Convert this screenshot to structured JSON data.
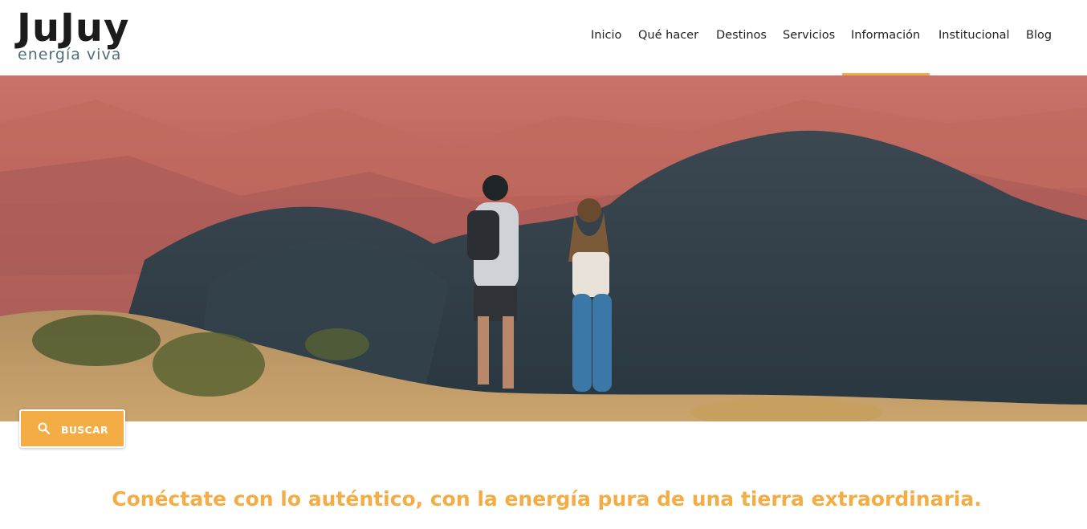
{
  "logo": {
    "title": "JuJuy",
    "subtitle": "energía viva"
  },
  "nav": {
    "items": [
      {
        "label": "Inicio"
      },
      {
        "label": "Qué hacer"
      },
      {
        "label": "Destinos"
      },
      {
        "label": "Servicios"
      },
      {
        "label": "Información"
      },
      {
        "label": "Institucional"
      },
      {
        "label": "Blog"
      }
    ],
    "active_index": 4
  },
  "hero": {
    "image_subject": "couple-holding-hands-overlooking-colorful-mountains"
  },
  "search": {
    "label": "BUSCAR",
    "icon": "search-icon"
  },
  "tagline": "Conéctate con lo auténtico, con la energía pura de una tierra extraordinaria.",
  "colors": {
    "accent": "#f4ad45",
    "text": "#222222",
    "logo_dark": "#1c1c1c",
    "logo_sub": "#4f6d78"
  }
}
